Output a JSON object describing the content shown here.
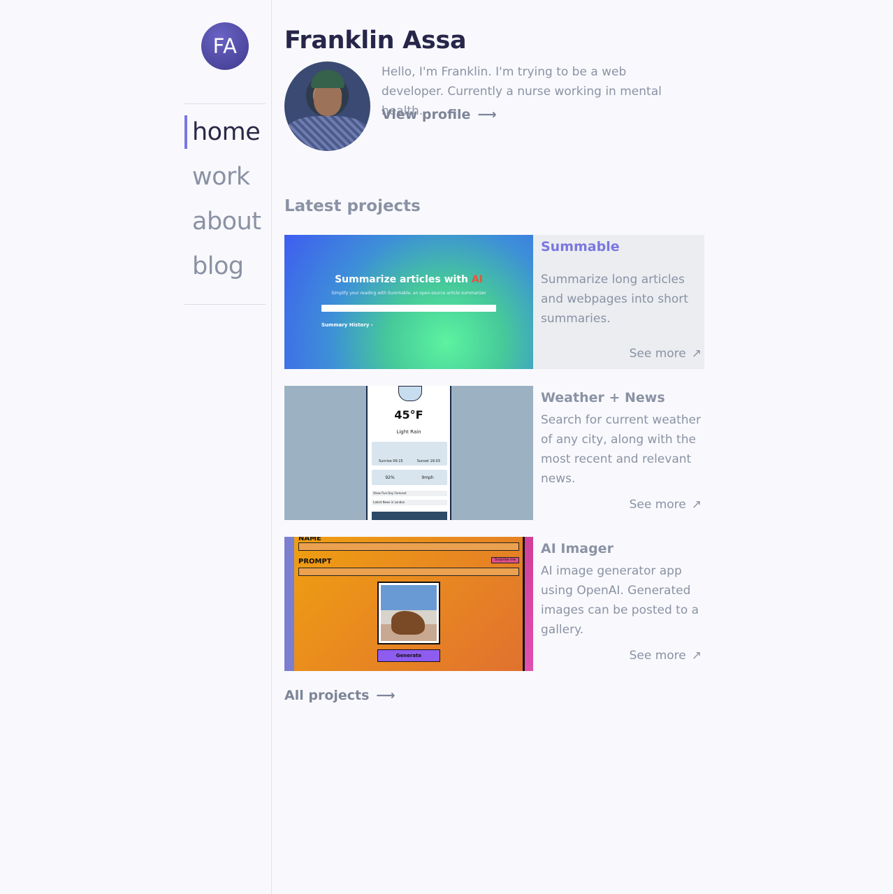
{
  "sidebar": {
    "logo": "FA",
    "nav": [
      {
        "label": "home",
        "active": true
      },
      {
        "label": "work",
        "active": false
      },
      {
        "label": "about",
        "active": false
      },
      {
        "label": "blog",
        "active": false
      }
    ]
  },
  "profile": {
    "name": "Franklin Assa",
    "bio": "Hello, I'm Franklin. I'm trying to be a web developer. Currently a nurse working in mental health.",
    "view_profile": "View profile",
    "arrow": "⟶"
  },
  "latest": {
    "heading": "Latest projects",
    "projects": [
      {
        "title": "Summable",
        "description": "Summarize long articles and webpages into short summaries.",
        "see_more": "See more",
        "thumb": {
          "headline": "Summarize articles with",
          "headline_ai": "AI",
          "sub": "Simplify your reading with Summable, an open-source article summarizer",
          "history": "Summary History ›"
        }
      },
      {
        "title": "Weather + News",
        "description": "Search for current weather of any city, along with the most recent and relevant news.",
        "see_more": "See more",
        "thumb": {
          "temp": "45°F",
          "cond": "Light Rain",
          "sunrise": "Sunrise 06:15",
          "sunset": "Sunset 16:03",
          "humidity": "92%",
          "wind": "9mph",
          "forecast": "Show Five Day Forecast",
          "news": "Latest News in London"
        }
      },
      {
        "title": "AI Imager",
        "description": "AI image generator app using OpenAI. Generated images can be posted to a gallery.",
        "see_more": "See more",
        "thumb": {
          "name_label": "NAME",
          "prompt_label": "PROMPT",
          "surprise": "Surprise me",
          "generate": "Generate"
        }
      }
    ],
    "all_projects": "All projects",
    "see_more_icon": "↗"
  }
}
